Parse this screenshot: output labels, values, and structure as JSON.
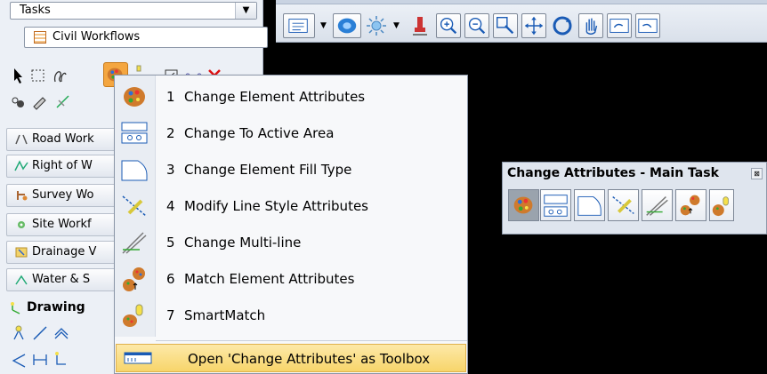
{
  "tasks_panel": {
    "title": "Tasks",
    "workflow": "Civil Workflows",
    "groups": [
      {
        "label": "Road Work"
      },
      {
        "label": "Right of W"
      },
      {
        "label": "Survey Wo"
      },
      {
        "label": "Site Workf"
      },
      {
        "label": "Drainage V"
      },
      {
        "label": "Water & S"
      }
    ],
    "drawing_label": "Drawing"
  },
  "toolbar": {
    "icons": [
      "attributes-view-icon",
      "level-display-icon",
      "light-icon",
      "paint-brush-icon",
      "zoom-in-icon",
      "zoom-out-icon",
      "window-area-icon",
      "fit-view-icon",
      "rotate-view-icon",
      "pan-icon",
      "previous-view-icon",
      "next-view-icon"
    ]
  },
  "context_menu": {
    "items": [
      {
        "num": "1",
        "label": "Change Element Attributes",
        "icon": "palette-icon"
      },
      {
        "num": "2",
        "label": "Change To Active Area",
        "icon": "active-area-icon"
      },
      {
        "num": "3",
        "label": "Change Element Fill Type",
        "icon": "fill-type-icon"
      },
      {
        "num": "4",
        "label": "Modify Line Style Attributes",
        "icon": "line-style-icon"
      },
      {
        "num": "5",
        "label": "Change Multi-line",
        "icon": "multiline-icon"
      },
      {
        "num": "6",
        "label": "Match Element Attributes",
        "icon": "match-attributes-icon"
      },
      {
        "num": "7",
        "label": "SmartMatch",
        "icon": "smartmatch-icon"
      }
    ],
    "footer": "Open 'Change Attributes' as Toolbox"
  },
  "toolbox": {
    "title": "Change Attributes - Main Task",
    "close_glyph": "⊠"
  },
  "colors": {
    "canvas": "#000000",
    "panel": "#ecf0f6",
    "menu_highlight": "#f7d56b"
  }
}
